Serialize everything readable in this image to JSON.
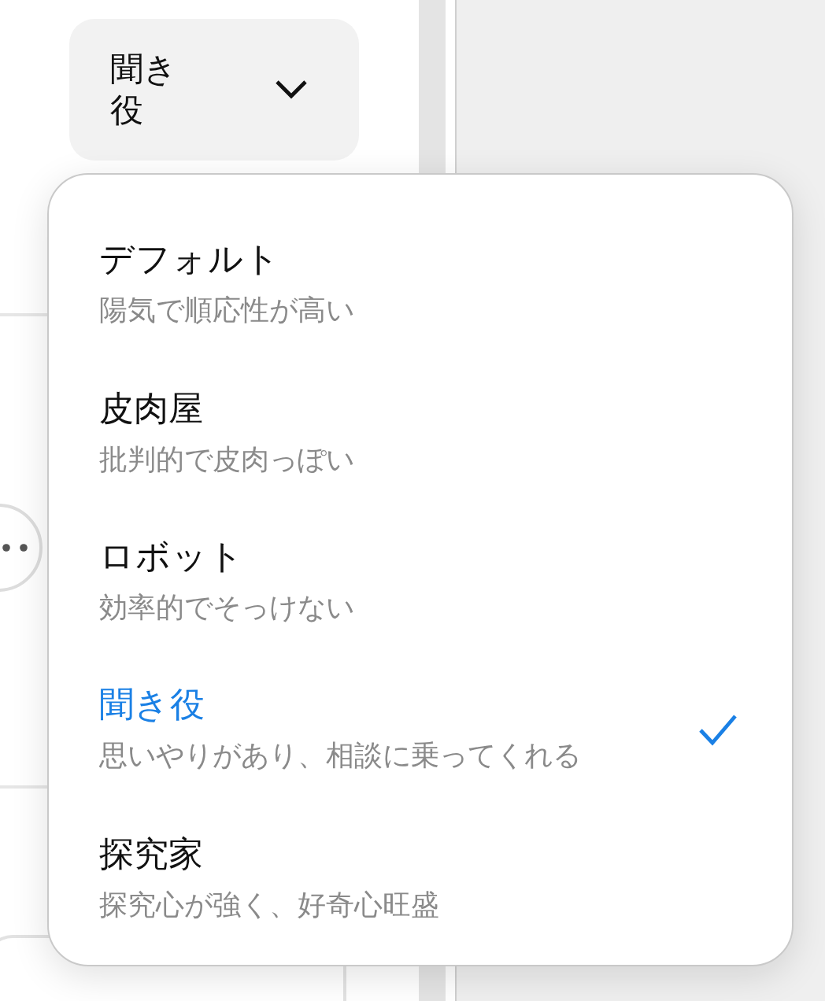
{
  "persona_selector": {
    "label": "聞き役"
  },
  "persona_menu": {
    "items": [
      {
        "title": "デフォルト",
        "description": "陽気で順応性が高い",
        "selected": false
      },
      {
        "title": "皮肉屋",
        "description": "批判的で皮肉っぽい",
        "selected": false
      },
      {
        "title": "ロボット",
        "description": "効率的でそっけない",
        "selected": false
      },
      {
        "title": "聞き役",
        "description": "思いやりがあり、相談に乗ってくれる",
        "selected": true
      },
      {
        "title": "探究家",
        "description": "探究心が強く、好奇心旺盛",
        "selected": false
      }
    ]
  }
}
